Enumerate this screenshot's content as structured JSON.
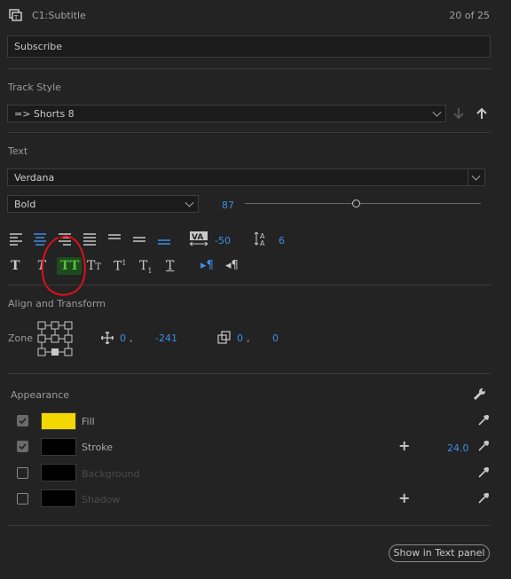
{
  "header": {
    "title": "C1:Subtitle",
    "counter": "20 of 25"
  },
  "caption_text": "Subscribe",
  "track_style": {
    "label": "Track Style",
    "value": "=> Shorts 8"
  },
  "text_section": {
    "label": "Text",
    "font": "Verdana",
    "weight": "Bold",
    "size": "87",
    "size_fraction": 0.47,
    "tracking": "-50",
    "leading": "6"
  },
  "align": {
    "label": "Align and Transform",
    "zone_label": "Zone",
    "pos_x": "0",
    "pos_y": "-241",
    "pos_sep": ",",
    "scale_x": "0",
    "scale_y": "0",
    "scale_sep": ","
  },
  "appearance": {
    "label": "Appearance",
    "rows": [
      {
        "label": "Fill",
        "checked": true,
        "color": "#f2d800"
      },
      {
        "label": "Stroke",
        "checked": true,
        "color": "#000000",
        "value": "24.0"
      },
      {
        "label": "Background",
        "checked": false,
        "color": "#000000"
      },
      {
        "label": "Shadow",
        "checked": false,
        "color": "#000000"
      }
    ]
  },
  "footer": {
    "show_button": "Show in Text panel"
  },
  "colors": {
    "accent": "#3d8ee6",
    "annotation": "#e0101a",
    "highlight": "#1e4a1e"
  }
}
